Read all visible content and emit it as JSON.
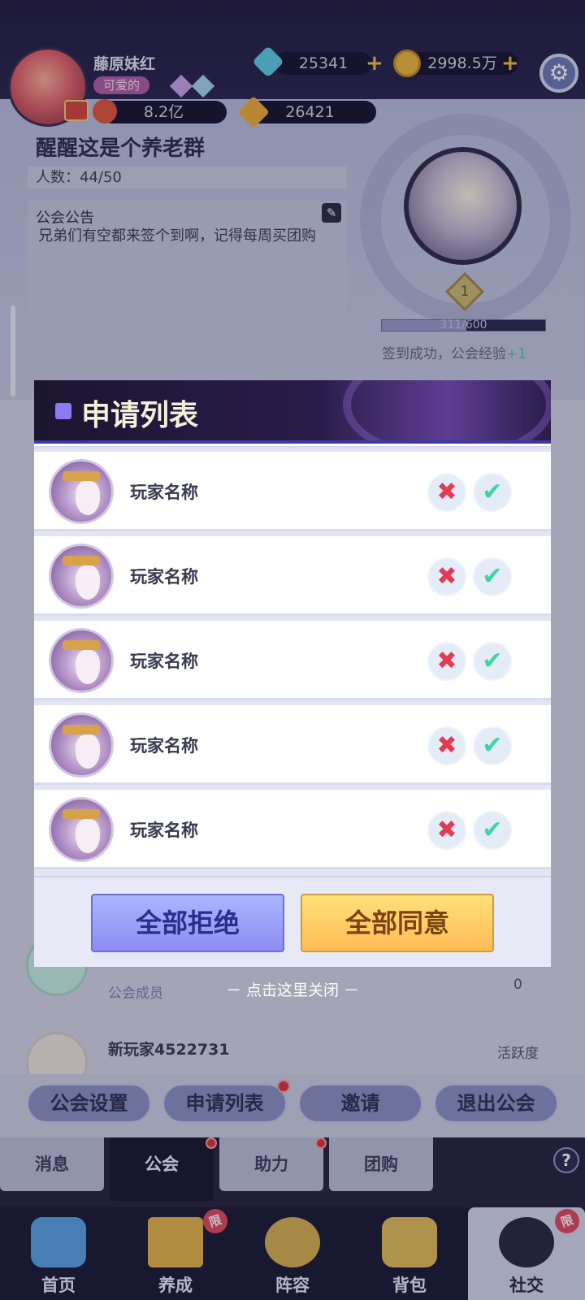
{
  "player": {
    "name": "藤原妹红",
    "tag": "可爱的",
    "diamonds": "25341",
    "gold": "2998.5万",
    "power": "8.2亿",
    "stars": "26421"
  },
  "guild": {
    "name": "醒醒这是个养老群",
    "members": "人数：44/50",
    "notice_title": "公会公告",
    "notice_text": "兄弟们有空都来签个到啊，记得每周买团购",
    "level": "1",
    "exp_text": "311/600",
    "exp_fraction": 0.518,
    "signin_text": "签到成功，公会经验",
    "signin_gain": "+1"
  },
  "background_list": [
    {
      "name": "新玩家4522731",
      "role": "公会成员",
      "activity_label": "活跃度",
      "activity": "0"
    },
    {
      "name": "新玩家4522731",
      "role": "",
      "activity_label": "活跃度",
      "activity": "0"
    }
  ],
  "guild_actions": [
    "公会设置",
    "申请列表",
    "邀请",
    "退出公会"
  ],
  "subtabs": [
    "消息",
    "公会",
    "助力",
    "团购"
  ],
  "nav": [
    "首页",
    "养成",
    "阵容",
    "背包",
    "社交"
  ],
  "badge_limited": "限",
  "help_glyph": "?",
  "modal": {
    "title": "申请列表",
    "reject_glyph": "✖",
    "accept_glyph": "✔",
    "applicants": [
      {
        "name": "玩家名称"
      },
      {
        "name": "玩家名称"
      },
      {
        "name": "玩家名称"
      },
      {
        "name": "玩家名称"
      },
      {
        "name": "玩家名称"
      }
    ],
    "reject_all": "全部拒绝",
    "accept_all": "全部同意",
    "close_hint": "－ 点击这里关闭 －"
  },
  "colors": {
    "accent_purple": "#8b7af2",
    "reject_red": "#e43b55",
    "accept_green": "#42d3a3",
    "gold_button": "#ffbb55",
    "blue_button": "#8e8cf3"
  }
}
